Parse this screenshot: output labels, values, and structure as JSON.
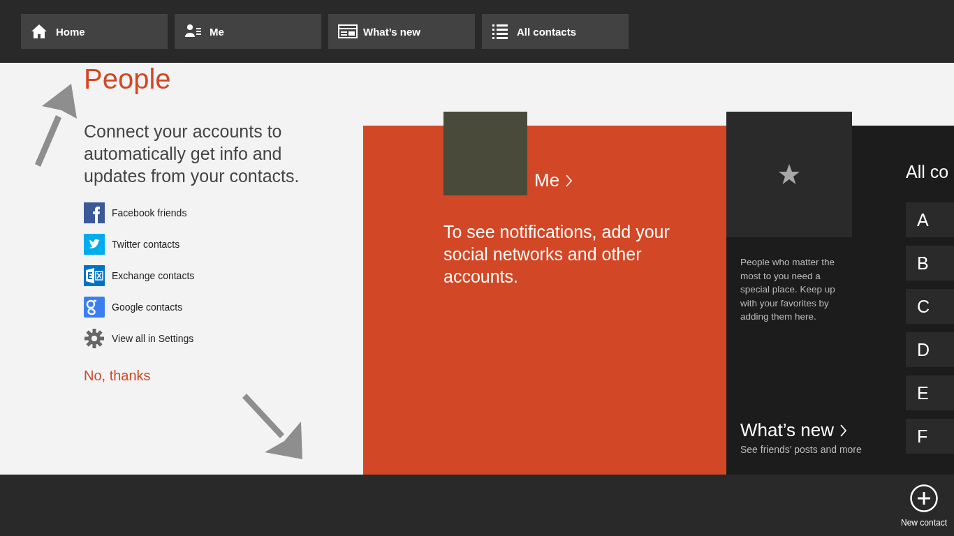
{
  "nav": [
    {
      "label": "Home"
    },
    {
      "label": "Me"
    },
    {
      "label": "What’s new"
    },
    {
      "label": "All contacts"
    }
  ],
  "title": "People",
  "connect": {
    "heading": "Connect your accounts to automatically get info and updates from your contacts.",
    "accounts": [
      {
        "label": "Facebook friends",
        "kind": "facebook"
      },
      {
        "label": "Twitter contacts",
        "kind": "twitter"
      },
      {
        "label": "Exchange contacts",
        "kind": "exchange"
      },
      {
        "label": "Google contacts",
        "kind": "google"
      },
      {
        "label": "View all in Settings",
        "kind": "settings"
      }
    ],
    "decline": "No, thanks"
  },
  "me_tile": {
    "label": "Me",
    "message": "To see notifications, add your social networks and other accounts."
  },
  "favorites": {
    "text": "People who matter the most to you need a special place. Keep up with your favorites by adding them here."
  },
  "whats_new": {
    "title": "What’s new",
    "subtitle": "See friends’ posts and more"
  },
  "all_contacts": {
    "heading": "All co",
    "letters": [
      "A",
      "B",
      "C",
      "D",
      "E",
      "F"
    ]
  },
  "app_bar": {
    "buttons": [
      {
        "label": "New contact"
      }
    ]
  }
}
